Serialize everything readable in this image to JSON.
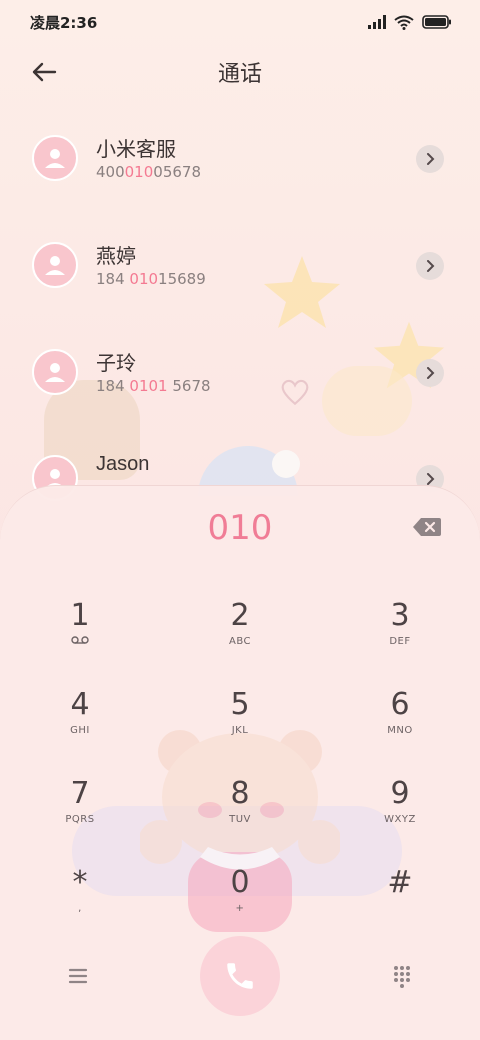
{
  "status_bar": {
    "time": "凌晨2:36"
  },
  "header": {
    "title": "通话"
  },
  "contacts": [
    {
      "name": "小米客服",
      "number_pre": "400",
      "number_hl": "010",
      "number_post": "05678"
    },
    {
      "name": "燕婷",
      "number_pre": "184 ",
      "number_hl": "010",
      "number_post": "15689"
    },
    {
      "name": "子玲",
      "number_pre": "184 ",
      "number_hl": "0101",
      "number_post": " 5678"
    },
    {
      "name": "Jason"
    }
  ],
  "dialer": {
    "input": "010",
    "keys": [
      {
        "digit": "1",
        "sub": "voicemail-icon"
      },
      {
        "digit": "2",
        "sub": "ABC"
      },
      {
        "digit": "3",
        "sub": "DEF"
      },
      {
        "digit": "4",
        "sub": "GHI"
      },
      {
        "digit": "5",
        "sub": "JKL"
      },
      {
        "digit": "6",
        "sub": "MNO"
      },
      {
        "digit": "7",
        "sub": "PQRS"
      },
      {
        "digit": "8",
        "sub": "TUV"
      },
      {
        "digit": "9",
        "sub": "WXYZ"
      },
      {
        "digit": "*",
        "sub": ","
      },
      {
        "digit": "0",
        "sub": "+"
      },
      {
        "digit": "#",
        "sub": ""
      }
    ]
  },
  "colors": {
    "accent": "#f07d96",
    "avatar": "#f9c6cd",
    "call_button": "#fbd3d9"
  }
}
